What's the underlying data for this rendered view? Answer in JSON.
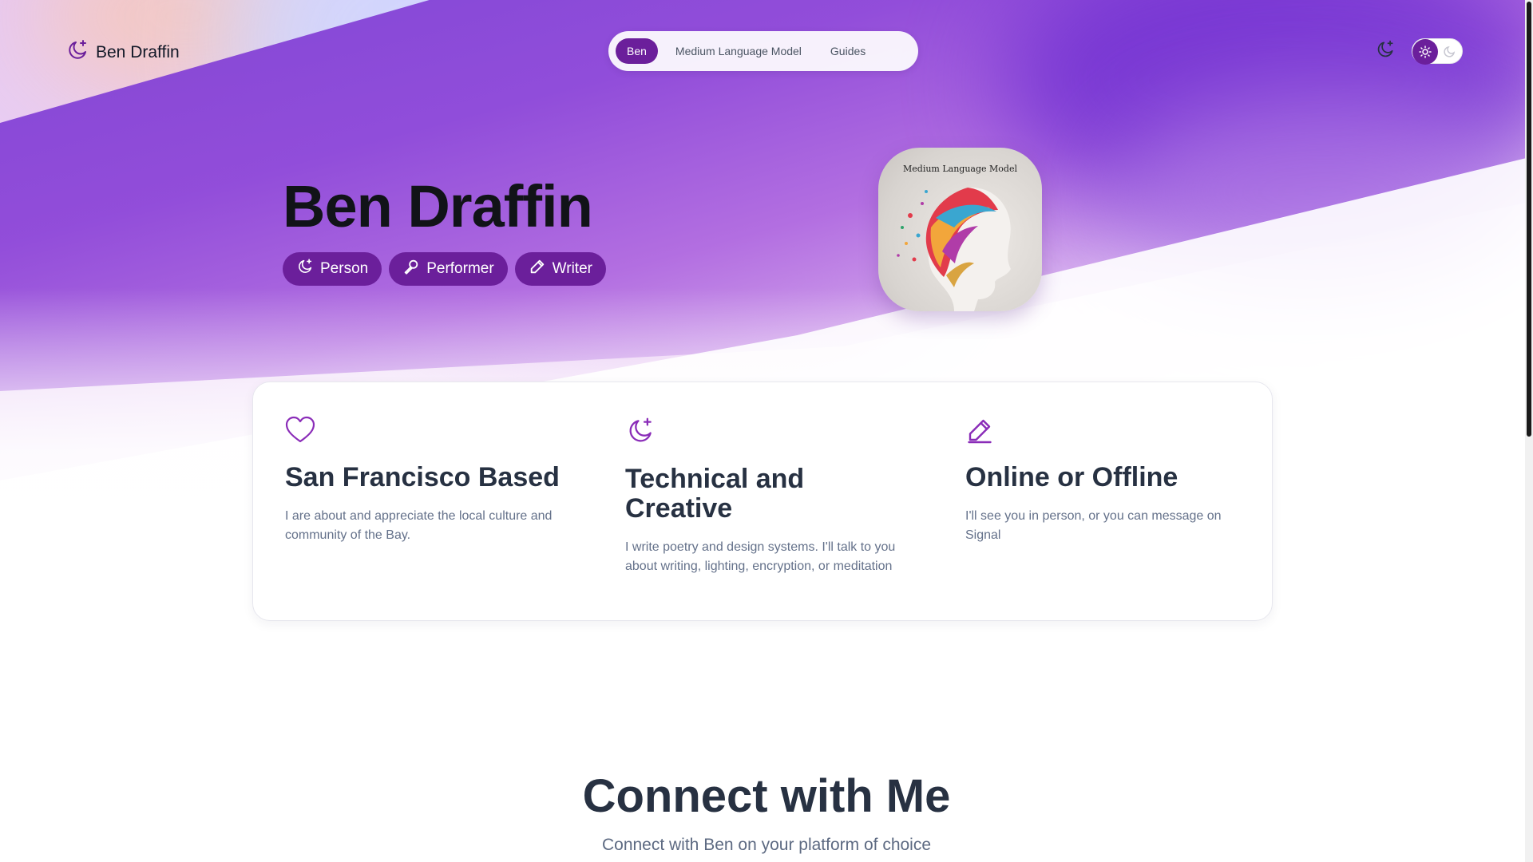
{
  "header": {
    "brand": "Ben Draffin",
    "nav": [
      {
        "label": "Ben",
        "active": true
      },
      {
        "label": "Medium Language Model",
        "active": false
      },
      {
        "label": "Guides",
        "active": false
      }
    ]
  },
  "hero": {
    "title": "Ben Draffin",
    "tags": [
      {
        "label": "Person",
        "icon": "moon-stars-icon"
      },
      {
        "label": "Performer",
        "icon": "microphone-icon"
      },
      {
        "label": "Writer",
        "icon": "pencil-icon"
      }
    ],
    "logo_title": "Medium Language Model"
  },
  "features": [
    {
      "icon": "heart-icon",
      "title": "San Francisco Based",
      "text": "I are about and appreciate the local culture and community of the Bay."
    },
    {
      "icon": "moon-stars-icon",
      "title": "Technical and Creative",
      "text": "I write poetry and design systems. I'll talk to you about writing, lighting, encryption, or meditation"
    },
    {
      "icon": "pencil-icon",
      "title": "Online or Offline",
      "text": "I'll see you in person, or you can message on Signal"
    }
  ],
  "connect": {
    "title": "Connect with Me",
    "subtitle": "Connect with Ben on your platform of choice"
  },
  "colors": {
    "accent": "#6b1f9b",
    "heading": "#273142"
  }
}
